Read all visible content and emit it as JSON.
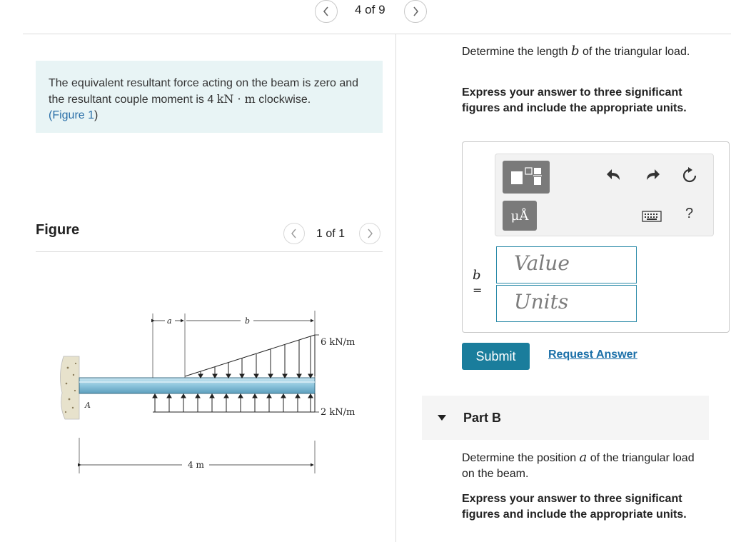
{
  "pagination": {
    "counter": "4 of 9"
  },
  "intro": {
    "text_before": "The equivalent resultant force acting on the beam is zero and the resultant couple moment is 4 ",
    "unit": "kN · m",
    "text_after": " clockwise.",
    "figure_link_open": "(",
    "figure_link": "Figure 1",
    "figure_link_close": ")"
  },
  "figure_panel": {
    "heading": "Figure",
    "counter": "1 of 1",
    "labels": {
      "a": "a",
      "b": "b",
      "load_top": "6 kN/m",
      "load_bottom": "2 kN/m",
      "support": "A",
      "length": "4 m"
    }
  },
  "part_a": {
    "prompt_before": "Determine the length ",
    "prompt_var": "b",
    "prompt_after": " of the triangular load.",
    "instructions": "Express your answer to three significant figures and include the appropriate units.",
    "variable": "b",
    "equals": "=",
    "value_placeholder": "Value",
    "units_placeholder": "Units",
    "toolbar": {
      "mu_a": "μÅ",
      "help": "?",
      "icons": [
        "templates-icon",
        "undo-icon",
        "redo-icon",
        "reset-icon",
        "keyboard-icon"
      ]
    },
    "submit": "Submit",
    "request_answer": "Request Answer"
  },
  "part_b": {
    "title": "Part B",
    "prompt_before": "Determine the position ",
    "prompt_var": "a",
    "prompt_after": " of the triangular load on the beam.",
    "instructions": "Express your answer to three significant figures and include the appropriate units."
  },
  "colors": {
    "accent": "#1a7d9c",
    "link": "#2a6fa8",
    "intro_bg": "#e8f4f5",
    "beam": "#8cc4dc"
  }
}
